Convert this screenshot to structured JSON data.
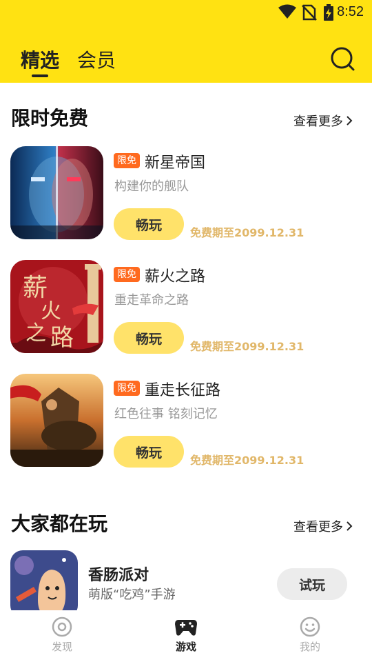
{
  "status_bar": {
    "time": "8:52",
    "icons": [
      "wifi-icon",
      "no-sim-icon",
      "battery-charging-icon"
    ]
  },
  "header": {
    "tabs": [
      {
        "label": "精选",
        "active": true
      },
      {
        "label": "会员",
        "active": false
      }
    ],
    "search_icon": "search-icon",
    "background": "#FFE212"
  },
  "limited_free": {
    "title": "限时免费",
    "more_label": "查看更多",
    "games": [
      {
        "badge": "限免",
        "title": "新星帝国",
        "subtitle": "构建你的舰队",
        "button": "畅玩",
        "free_until": "免费期至2099.12.31"
      },
      {
        "badge": "限免",
        "title": "薪火之路",
        "subtitle": "重走革命之路",
        "button": "畅玩",
        "free_until": "免费期至2099.12.31"
      },
      {
        "badge": "限免",
        "title": "重走长征路",
        "subtitle": "红色往事 铭刻记忆",
        "button": "畅玩",
        "free_until": "免费期至2099.12.31"
      }
    ]
  },
  "popular": {
    "title": "大家都在玩",
    "more_label": "查看更多",
    "games": [
      {
        "title": "香肠派对",
        "subtitle": "萌版“吃鸡”手游",
        "button": "试玩"
      }
    ]
  },
  "bottom_nav": {
    "items": [
      {
        "label": "发现",
        "icon": "disc-icon",
        "active": false
      },
      {
        "label": "游戏",
        "icon": "gamepad-icon",
        "active": true
      },
      {
        "label": "我的",
        "icon": "smiley-icon",
        "active": false
      }
    ]
  },
  "colors": {
    "accent_yellow": "#FFE212",
    "badge_orange": "#FF6A1F",
    "free_text_gold": "#E1B769",
    "button_yellow": "#FFE26A"
  }
}
